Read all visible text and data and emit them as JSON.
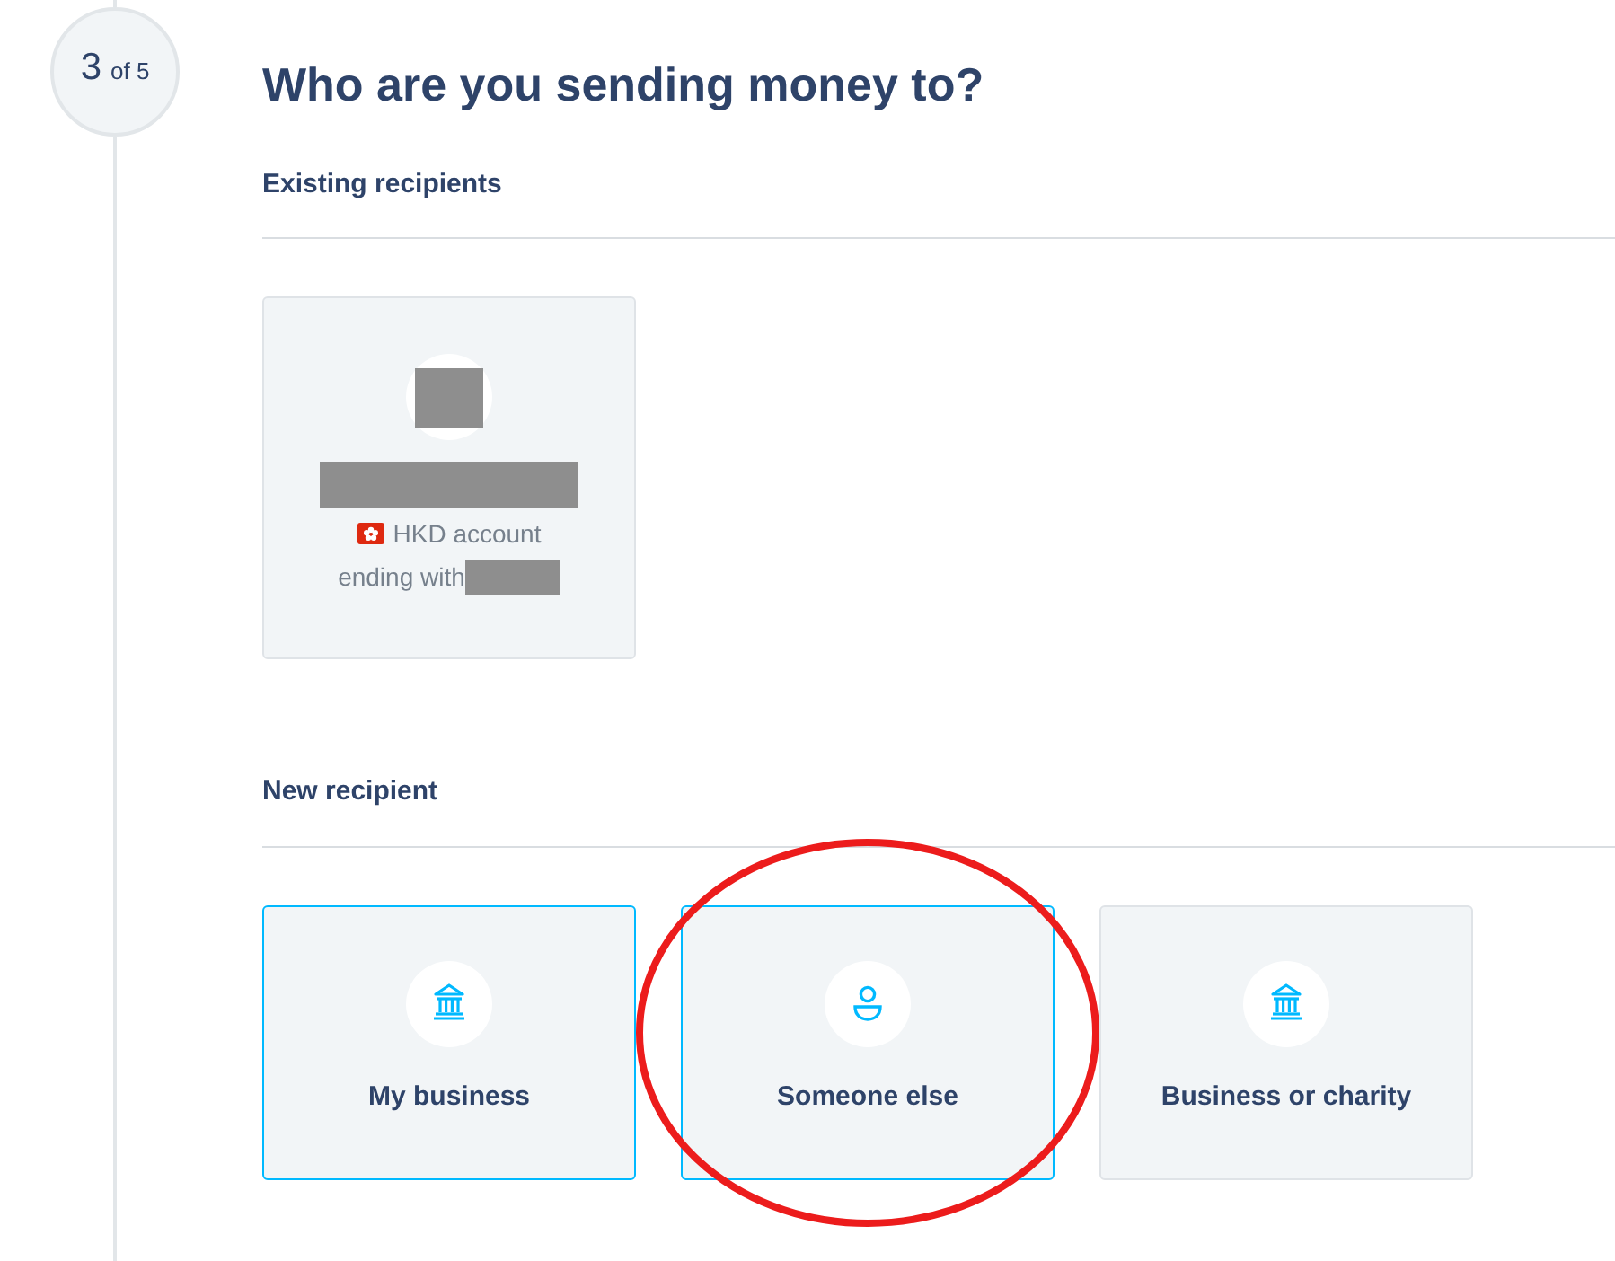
{
  "step": {
    "current": "3",
    "total": "of 5"
  },
  "title": "Who are you sending money to?",
  "existing_recipients": {
    "heading": "Existing recipients",
    "recipients": [
      {
        "avatar_redacted": true,
        "name_redacted": true,
        "account_label": "HKD account",
        "account_ending": "ending with",
        "account_number_redacted": true
      }
    ]
  },
  "new_recipient": {
    "heading": "New recipient",
    "options": [
      {
        "label": "My business",
        "kind": "bank",
        "selected": true,
        "circled": false
      },
      {
        "label": "Someone else",
        "kind": "person",
        "selected": true,
        "circled": true
      },
      {
        "label": "Business or charity",
        "kind": "bank",
        "selected": false,
        "circled": false
      }
    ]
  }
}
